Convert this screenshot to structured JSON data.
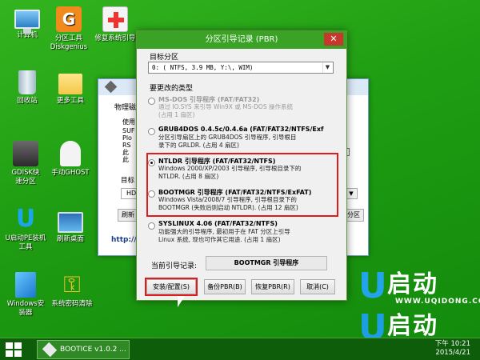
{
  "desktop": {
    "icons": [
      {
        "label": "计算机",
        "icon": "computer-icon"
      },
      {
        "label": "分区工具\nDiskgenius",
        "icon": "diskgenius-icon"
      },
      {
        "label": "修复系统引导",
        "icon": "repair-boot-icon"
      },
      {
        "label": "回收站",
        "icon": "recycle-bin-icon"
      },
      {
        "label": "更多工具",
        "icon": "folder-icon"
      },
      {
        "label": "GDISK快速分区",
        "icon": "gdisk-icon"
      },
      {
        "label": "手动GHOST",
        "icon": "ghost-icon"
      },
      {
        "label": "U启动PE装机工具",
        "icon": "u-installer-icon"
      },
      {
        "label": "刷新桌面",
        "icon": "refresh-desktop-icon"
      },
      {
        "label": "Windows安装器",
        "icon": "windows-installer-icon"
      },
      {
        "label": "系统密码清除",
        "icon": "key-icon"
      }
    ]
  },
  "bg_window": {
    "labels": [
      "物理磁",
      "使用",
      "目标",
      "刷新",
      "http://"
    ],
    "body_text": "SUF\nPlo\nRS\n此\n此",
    "target_value": "HD",
    "left_button": "刷新",
    "right_button": "分区"
  },
  "dialog": {
    "title": "分区引导记录 (PBR)",
    "close": "✕",
    "target_partition_label": "目标分区",
    "partition_value": "0: ( NTFS,   3.9 MB, Y:\\, WIM)",
    "type_label": "要更改的类型",
    "options": [
      {
        "title": "MS-DOS 引导程序 (FAT/FAT32)",
        "desc": "通过 IO.SYS 来引导 Win9X 或 MS-DOS 操作系统\n(占用 1 扇区)",
        "selected": false,
        "disabled": true
      },
      {
        "title": "GRUB4DOS 0.4.5c/0.4.6a (FAT/FAT32/NTFS/Exf",
        "desc": "分区引导扇区上的 GRUB4DOS 引导程序, 引导根目\n录下的 GRLDR. (占用 4 扇区)",
        "selected": false,
        "disabled": false
      },
      {
        "title": "NTLDR 引导程序 (FAT/FAT32/NTFS)",
        "desc": "Windows 2000/XP/2003 引导程序, 引导根目录下的\nNTLDR. (占用 8 扇区)",
        "selected": true,
        "disabled": false
      },
      {
        "title": "BOOTMGR 引导程序 (FAT/FAT32/NTFS/ExFAT)",
        "desc": "Windows Vista/2008/7 引导程序, 引导根目录下的\nBOOTMGR (失败后则启动 NTLDR). (占用 12 扇区)",
        "selected": false,
        "disabled": false
      },
      {
        "title": "SYSLINUX 4.06 (FAT/FAT32/NTFS)",
        "desc": "功能强大的引导程序, 最初用于在 FAT 分区上引导\nLinux 系统, 现也可作其它用途. (占用 1 扇区)",
        "selected": false,
        "disabled": false
      }
    ],
    "current_label": "当前引导记录:",
    "current_value": "BOOTMGR 引导程序",
    "buttons": {
      "install": "安装/配置(S)",
      "backup": "备份PBR(B)",
      "restore": "恢复PBR(R)",
      "cancel": "取消(C)"
    },
    "highlight_color": "#e01b1b"
  },
  "logo": {
    "text": "启动",
    "url": "WWW.UQIDONG.COM"
  },
  "taskbar": {
    "app_label": "BOOTICE v1.0.2 ...",
    "time": "下午 10:21",
    "date": "2015/4/21"
  }
}
